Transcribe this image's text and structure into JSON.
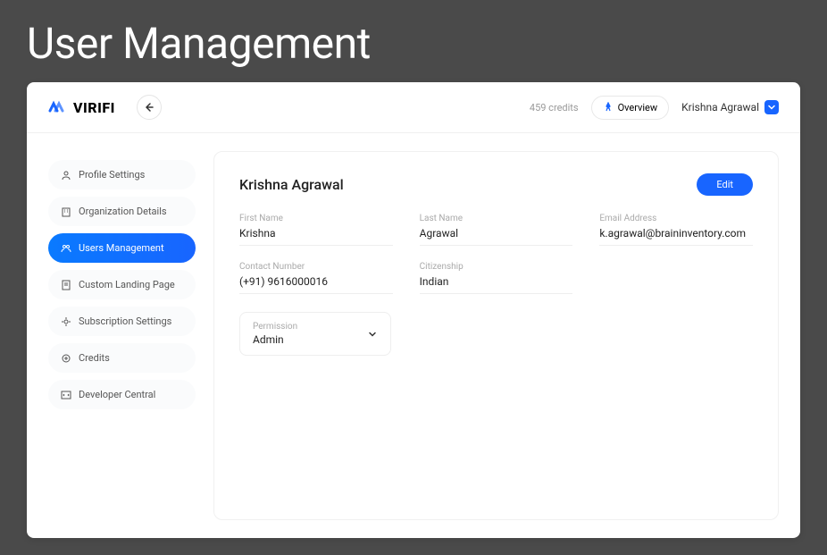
{
  "pageTitle": "User Management",
  "header": {
    "logoText": "VIRIFI",
    "credits": "459 credits",
    "overviewLabel": "Overview",
    "userName": "Krishna Agrawal"
  },
  "sidebar": {
    "items": [
      {
        "label": "Profile Settings",
        "icon": "user"
      },
      {
        "label": "Organization Details",
        "icon": "building"
      },
      {
        "label": "Users Management",
        "icon": "users",
        "active": true
      },
      {
        "label": "Custom Landing Page",
        "icon": "page"
      },
      {
        "label": "Subscription Settings",
        "icon": "gear"
      },
      {
        "label": "Credits",
        "icon": "credits"
      },
      {
        "label": "Developer Central",
        "icon": "code"
      }
    ]
  },
  "panel": {
    "title": "Krishna Agrawal",
    "editLabel": "Edit",
    "fields": {
      "firstName": {
        "label": "First Name",
        "value": "Krishna"
      },
      "lastName": {
        "label": "Last Name",
        "value": "Agrawal"
      },
      "email": {
        "label": "Email Address",
        "value": "k.agrawal@braininventory.com"
      },
      "contact": {
        "label": "Contact Number",
        "value": "(+91) 9616000016"
      },
      "citizenship": {
        "label": "Citizenship",
        "value": "Indian"
      }
    },
    "permission": {
      "label": "Permission",
      "value": "Admin"
    }
  }
}
